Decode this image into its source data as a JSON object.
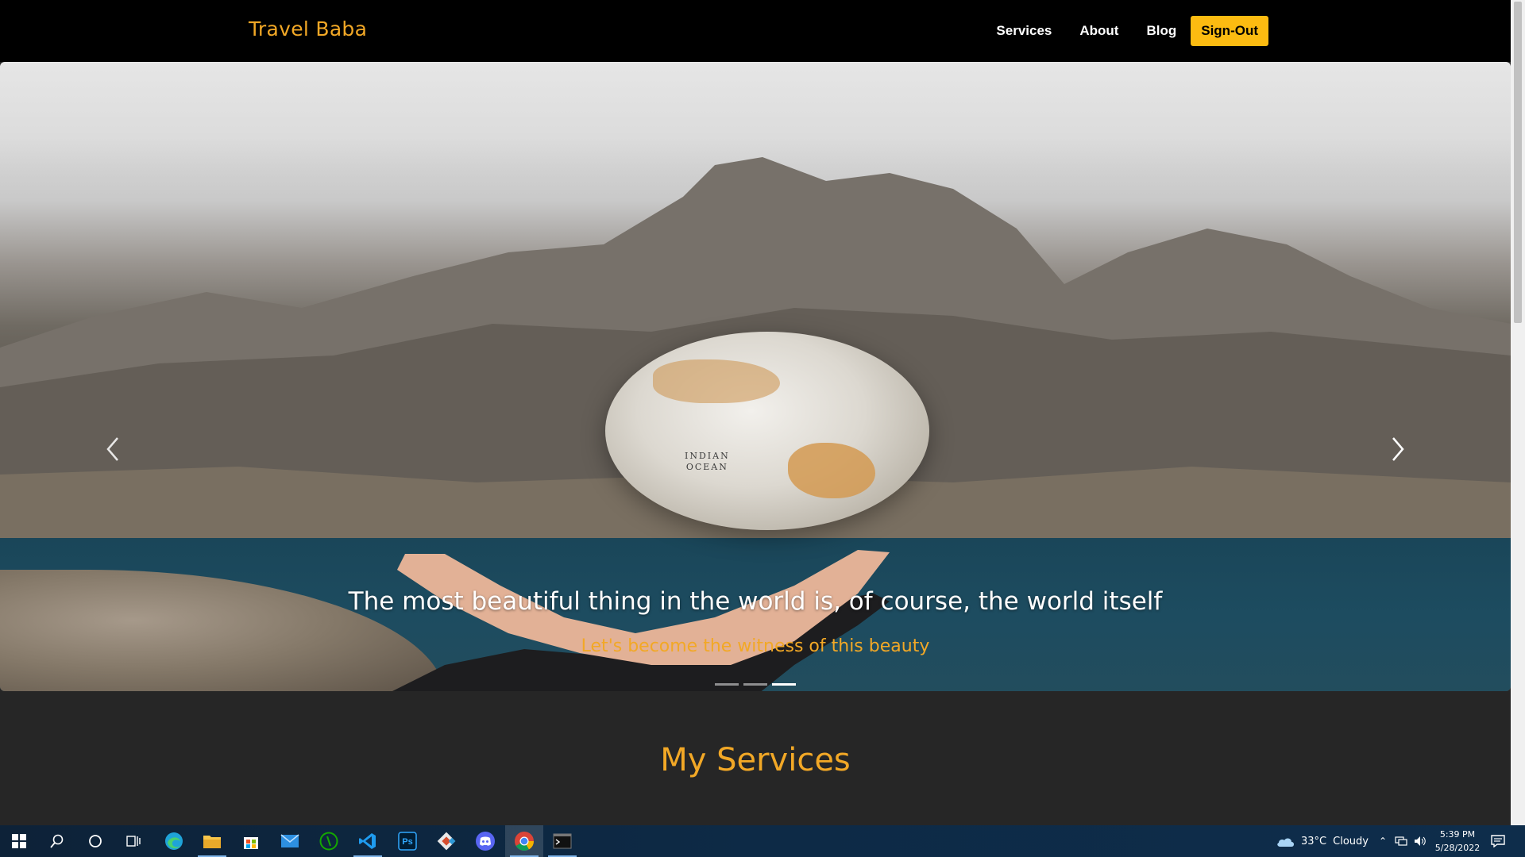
{
  "navbar": {
    "brand": "Travel Baba",
    "links": [
      "Services",
      "About",
      "Blog"
    ],
    "signout_label": "Sign-Out"
  },
  "hero": {
    "title": "The most beautiful thing in the world is, of course, the world itself",
    "subtitle": "Let's become the witness of this beauty",
    "globe_label_line1": "INDIAN",
    "globe_label_line2": "OCEAN",
    "slide_count": 3,
    "active_slide": 3
  },
  "services": {
    "heading": "My Services"
  },
  "taskbar": {
    "weather_temp": "33°C",
    "weather_desc": "Cloudy",
    "time": "5:39 PM",
    "date": "5/28/2022",
    "icons": [
      "windows-start-icon",
      "search-icon",
      "cortana-icon",
      "task-view-icon",
      "edge-icon",
      "file-explorer-icon",
      "store-icon",
      "mail-icon",
      "upwork-icon",
      "vscode-icon",
      "photoshop-icon",
      "git-icon",
      "discord-icon",
      "chrome-icon",
      "terminal-icon"
    ]
  },
  "colors": {
    "accent": "#f2a826",
    "button": "#fcbb11",
    "navbar_bg": "#000000",
    "section_bg": "#262626"
  }
}
